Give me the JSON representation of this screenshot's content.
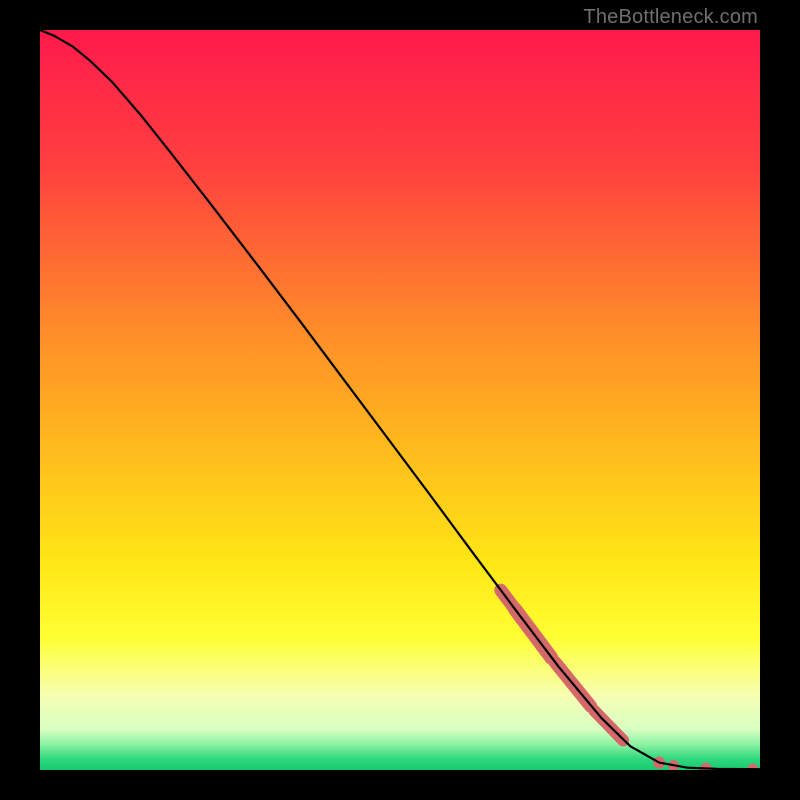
{
  "watermark": "TheBottleneck.com",
  "chart_data": {
    "type": "line",
    "title": "",
    "xlabel": "",
    "ylabel": "",
    "xlim": [
      0,
      100
    ],
    "ylim": [
      0,
      100
    ],
    "gradient_stops": [
      {
        "offset": 0.0,
        "color": "#ff1a4b"
      },
      {
        "offset": 0.18,
        "color": "#ff3f3f"
      },
      {
        "offset": 0.4,
        "color": "#ff8a2a"
      },
      {
        "offset": 0.56,
        "color": "#ffb91e"
      },
      {
        "offset": 0.72,
        "color": "#ffe615"
      },
      {
        "offset": 0.82,
        "color": "#ffff33"
      },
      {
        "offset": 0.9,
        "color": "#f6ffb3"
      },
      {
        "offset": 0.945,
        "color": "#d8ffc3"
      },
      {
        "offset": 0.965,
        "color": "#8ef2a2"
      },
      {
        "offset": 0.985,
        "color": "#2fd87e"
      },
      {
        "offset": 1.0,
        "color": "#17c96e"
      }
    ],
    "series": [
      {
        "name": "curve",
        "color": "#000000",
        "points": [
          {
            "x": 0.0,
            "y": 100.0
          },
          {
            "x": 2.0,
            "y": 99.2
          },
          {
            "x": 4.5,
            "y": 97.8
          },
          {
            "x": 7.0,
            "y": 95.8
          },
          {
            "x": 10.0,
            "y": 93.0
          },
          {
            "x": 14.0,
            "y": 88.5
          },
          {
            "x": 18.0,
            "y": 83.6
          },
          {
            "x": 24.0,
            "y": 76.1
          },
          {
            "x": 30.0,
            "y": 68.5
          },
          {
            "x": 36.0,
            "y": 60.8
          },
          {
            "x": 42.0,
            "y": 53.0
          },
          {
            "x": 48.0,
            "y": 45.2
          },
          {
            "x": 54.0,
            "y": 37.4
          },
          {
            "x": 60.0,
            "y": 29.5
          },
          {
            "x": 66.0,
            "y": 21.7
          },
          {
            "x": 72.0,
            "y": 14.0
          },
          {
            "x": 78.0,
            "y": 7.0
          },
          {
            "x": 82.0,
            "y": 3.2
          },
          {
            "x": 86.0,
            "y": 1.0
          },
          {
            "x": 90.0,
            "y": 0.3
          },
          {
            "x": 94.0,
            "y": 0.15
          },
          {
            "x": 100.0,
            "y": 0.1
          }
        ]
      }
    ],
    "marker_segments": [
      {
        "x0": 64.0,
        "y0": 24.3,
        "x1": 66.0,
        "y1": 21.7,
        "r": 6.5
      },
      {
        "x0": 66.0,
        "y0": 21.7,
        "x1": 71.0,
        "y1": 15.2,
        "r": 7.0
      },
      {
        "x0": 71.5,
        "y0": 14.6,
        "x1": 76.5,
        "y1": 8.6,
        "r": 6.5
      },
      {
        "x0": 77.0,
        "y0": 8.0,
        "x1": 81.0,
        "y1": 4.0,
        "r": 6.0
      }
    ],
    "marker_points": [
      {
        "x": 86.0,
        "y": 1.0,
        "r": 6.0
      },
      {
        "x": 88.0,
        "y": 0.6,
        "r": 5.5
      },
      {
        "x": 92.5,
        "y": 0.25,
        "r": 5.5
      },
      {
        "x": 99.0,
        "y": 0.12,
        "r": 5.5
      }
    ],
    "marker_color": "#d56969"
  }
}
